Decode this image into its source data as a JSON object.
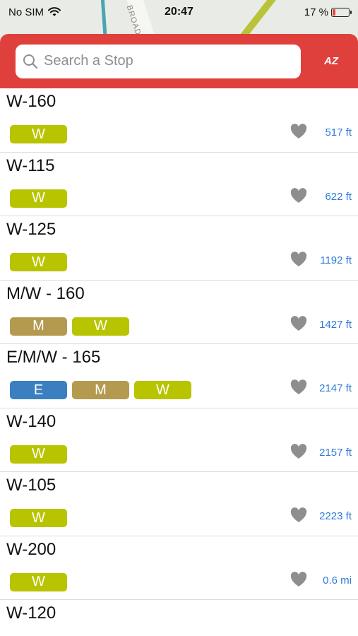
{
  "status_bar": {
    "carrier": "No SIM",
    "time": "20:47",
    "battery": "17 %",
    "battery_level": 0.17
  },
  "map": {
    "road_label": "BROADW"
  },
  "header": {
    "search_placeholder": "Search a Stop",
    "sort_label": "AZ"
  },
  "colors": {
    "header": "#e0403c",
    "line_W": "#b8c400",
    "line_M": "#b39a4f",
    "line_E": "#3c7fc0",
    "distance": "#2f7ad6"
  },
  "stops": [
    {
      "name": "W-160",
      "lines": [
        {
          "label": "W",
          "color": "#b8c400"
        }
      ],
      "distance": "517 ft"
    },
    {
      "name": "W-115",
      "lines": [
        {
          "label": "W",
          "color": "#b8c400"
        }
      ],
      "distance": "622 ft"
    },
    {
      "name": "W-125",
      "lines": [
        {
          "label": "W",
          "color": "#b8c400"
        }
      ],
      "distance": "1192 ft"
    },
    {
      "name": "M/W - 160",
      "lines": [
        {
          "label": "M",
          "color": "#b39a4f"
        },
        {
          "label": "W",
          "color": "#b8c400"
        }
      ],
      "distance": "1427 ft"
    },
    {
      "name": "E/M/W - 165",
      "lines": [
        {
          "label": "E",
          "color": "#3c7fc0"
        },
        {
          "label": "M",
          "color": "#b39a4f"
        },
        {
          "label": "W",
          "color": "#b8c400"
        }
      ],
      "distance": "2147 ft"
    },
    {
      "name": "W-140",
      "lines": [
        {
          "label": "W",
          "color": "#b8c400"
        }
      ],
      "distance": "2157 ft"
    },
    {
      "name": "W-105",
      "lines": [
        {
          "label": "W",
          "color": "#b8c400"
        }
      ],
      "distance": "2223 ft"
    },
    {
      "name": "W-200",
      "lines": [
        {
          "label": "W",
          "color": "#b8c400"
        }
      ],
      "distance": "0.6 mi"
    },
    {
      "name": "W-120",
      "lines": [],
      "distance": ""
    }
  ]
}
